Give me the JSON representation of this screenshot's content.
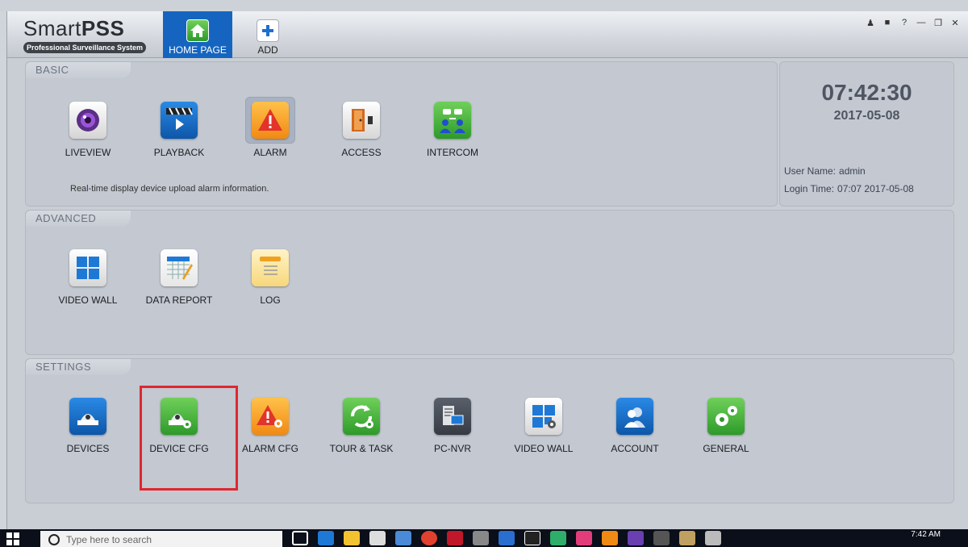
{
  "app": {
    "logo_main": "Smart",
    "logo_bold": "PSS",
    "logo_sub": "Professional Surveillance System",
    "tabs": [
      {
        "label": "HOME PAGE",
        "icon": "home-icon",
        "active": true
      },
      {
        "label": "ADD",
        "icon": "plus-icon",
        "active": false
      }
    ]
  },
  "sections": {
    "basic": {
      "title": "BASIC",
      "hint": "Real-time display device upload alarm information.",
      "items": [
        {
          "label": "LIVEVIEW",
          "icon": "camera-lens-icon"
        },
        {
          "label": "PLAYBACK",
          "icon": "clapperboard-play-icon"
        },
        {
          "label": "ALARM",
          "icon": "warning-icon"
        },
        {
          "label": "ACCESS",
          "icon": "door-icon"
        },
        {
          "label": "INTERCOM",
          "icon": "intercom-people-icon"
        }
      ]
    },
    "advanced": {
      "title": "ADVANCED",
      "items": [
        {
          "label": "VIDEO WALL",
          "icon": "video-wall-icon"
        },
        {
          "label": "DATA REPORT",
          "icon": "report-pencil-icon"
        },
        {
          "label": "LOG",
          "icon": "notepad-icon"
        }
      ]
    },
    "settings": {
      "title": "SETTINGS",
      "items": [
        {
          "label": "DEVICES",
          "icon": "dome-camera-icon"
        },
        {
          "label": "DEVICE CFG",
          "icon": "dome-camera-gear-icon"
        },
        {
          "label": "ALARM CFG",
          "icon": "warning-gear-icon"
        },
        {
          "label": "TOUR & TASK",
          "icon": "refresh-gear-icon"
        },
        {
          "label": "PC-NVR",
          "icon": "pc-nvr-icon"
        },
        {
          "label": "VIDEO WALL",
          "icon": "video-wall-gear-icon"
        },
        {
          "label": "ACCOUNT",
          "icon": "users-icon"
        },
        {
          "label": "GENERAL",
          "icon": "gears-icon"
        }
      ]
    }
  },
  "clock": {
    "time": "07:42:30",
    "date": "2017-05-08",
    "user_label": "User Name:",
    "user_value": "admin",
    "login_label": "Login Time:",
    "login_value": "07:07 2017-05-08"
  },
  "taskbar": {
    "search_placeholder": "Type here to search",
    "time": "7:42 AM"
  },
  "colors": {
    "accent": "#1565c0",
    "highlight_border": "#e0262f"
  }
}
